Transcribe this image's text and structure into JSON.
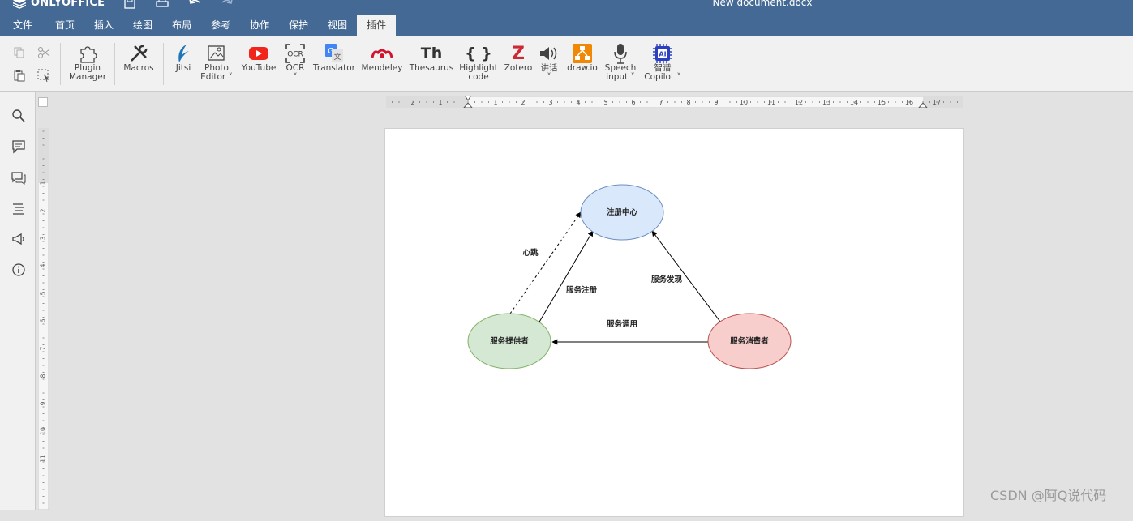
{
  "app": {
    "logo_text": "ONLYOFFICE",
    "document_title": "New document.docx"
  },
  "menu": [
    {
      "label": "文件"
    },
    {
      "label": "首页"
    },
    {
      "label": "插入"
    },
    {
      "label": "绘图"
    },
    {
      "label": "布局"
    },
    {
      "label": "参考"
    },
    {
      "label": "协作"
    },
    {
      "label": "保护"
    },
    {
      "label": "视图"
    },
    {
      "label": "插件"
    }
  ],
  "toolbar": {
    "plugin_manager": [
      "Plugin",
      "Manager"
    ],
    "macros": "Macros",
    "jitsi": "Jitsi",
    "photo_editor": [
      "Photo",
      "Editor"
    ],
    "youtube": "YouTube",
    "ocr": "OCR",
    "ocr_icon_text": "OCR",
    "translator": "Translator",
    "mendeley": "Mendeley",
    "thesaurus": "Thesaurus",
    "thesaurus_icon_text": "Th",
    "highlight_code": [
      "Highlight",
      "code"
    ],
    "highlight_icon_text": "{ }",
    "zotero": "Zotero",
    "zotero_icon_text": "Z",
    "speak": "讲话",
    "drawio": "draw.io",
    "speech_input": [
      "Speech",
      "input"
    ],
    "copilot": [
      "智谱",
      "Copilot"
    ],
    "copilot_icon_text": "AI"
  },
  "ruler": {
    "h_labels": [
      "2",
      "1",
      "1",
      "2",
      "3",
      "4",
      "5",
      "6",
      "7",
      "8",
      "9",
      "10",
      "11",
      "12",
      "13",
      "14",
      "15",
      "16",
      "17"
    ],
    "v_labels": [
      "1",
      "2",
      "3",
      "4",
      "5",
      "6",
      "7",
      "8",
      "9",
      "10",
      "11"
    ]
  },
  "diagram": {
    "registry": "注册中心",
    "provider": "服务提供者",
    "consumer": "服务消费者",
    "heartbeat": "心跳",
    "register": "服务注册",
    "discover": "服务发现",
    "invoke": "服务调用"
  },
  "colors": {
    "titlebar": "#446995",
    "registry_fill": "#dae8fc",
    "registry_stroke": "#6c8ebf",
    "provider_fill": "#d5e8d4",
    "provider_stroke": "#82b366",
    "consumer_fill": "#f8cecc",
    "consumer_stroke": "#b85450"
  },
  "watermark": "CSDN @阿Q说代码"
}
